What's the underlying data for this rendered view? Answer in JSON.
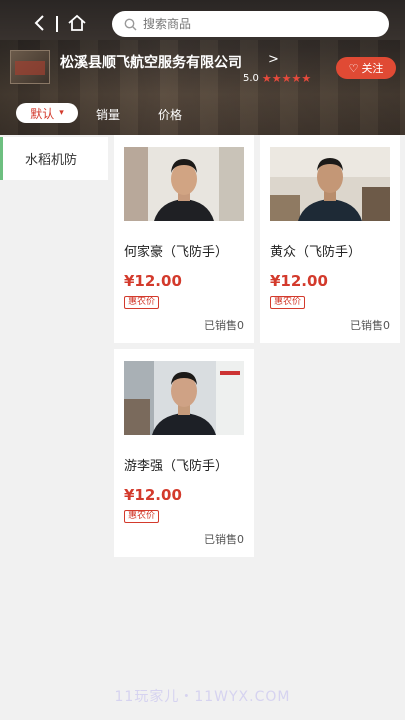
{
  "topbar": {
    "back_icon": "chevron-left-icon",
    "home_icon": "home-icon",
    "search_icon": "search-icon",
    "search_placeholder": "搜索商品"
  },
  "shop": {
    "name": "松溪县顺飞航空服务有限公司",
    "arrow": ">",
    "rating": "5.0",
    "stars": 5,
    "follow_label": "关注",
    "accent": "#e04a34"
  },
  "sort": {
    "default_label": "默认",
    "sales_label": "销量",
    "price_label": "价格"
  },
  "categories": [
    {
      "label": "水稻机防",
      "active": true
    }
  ],
  "products": [
    {
      "title": "何家豪（飞防手）",
      "price": "¥12.00",
      "tag": "惠农价",
      "sold": "已销售0"
    },
    {
      "title": "黄众（飞防手）",
      "price": "¥12.00",
      "tag": "惠农价",
      "sold": "已销售0"
    },
    {
      "title": "游李强（飞防手）",
      "price": "¥12.00",
      "tag": "惠农价",
      "sold": "已销售0"
    }
  ],
  "watermark": "11玩家儿・11WYX.COM"
}
